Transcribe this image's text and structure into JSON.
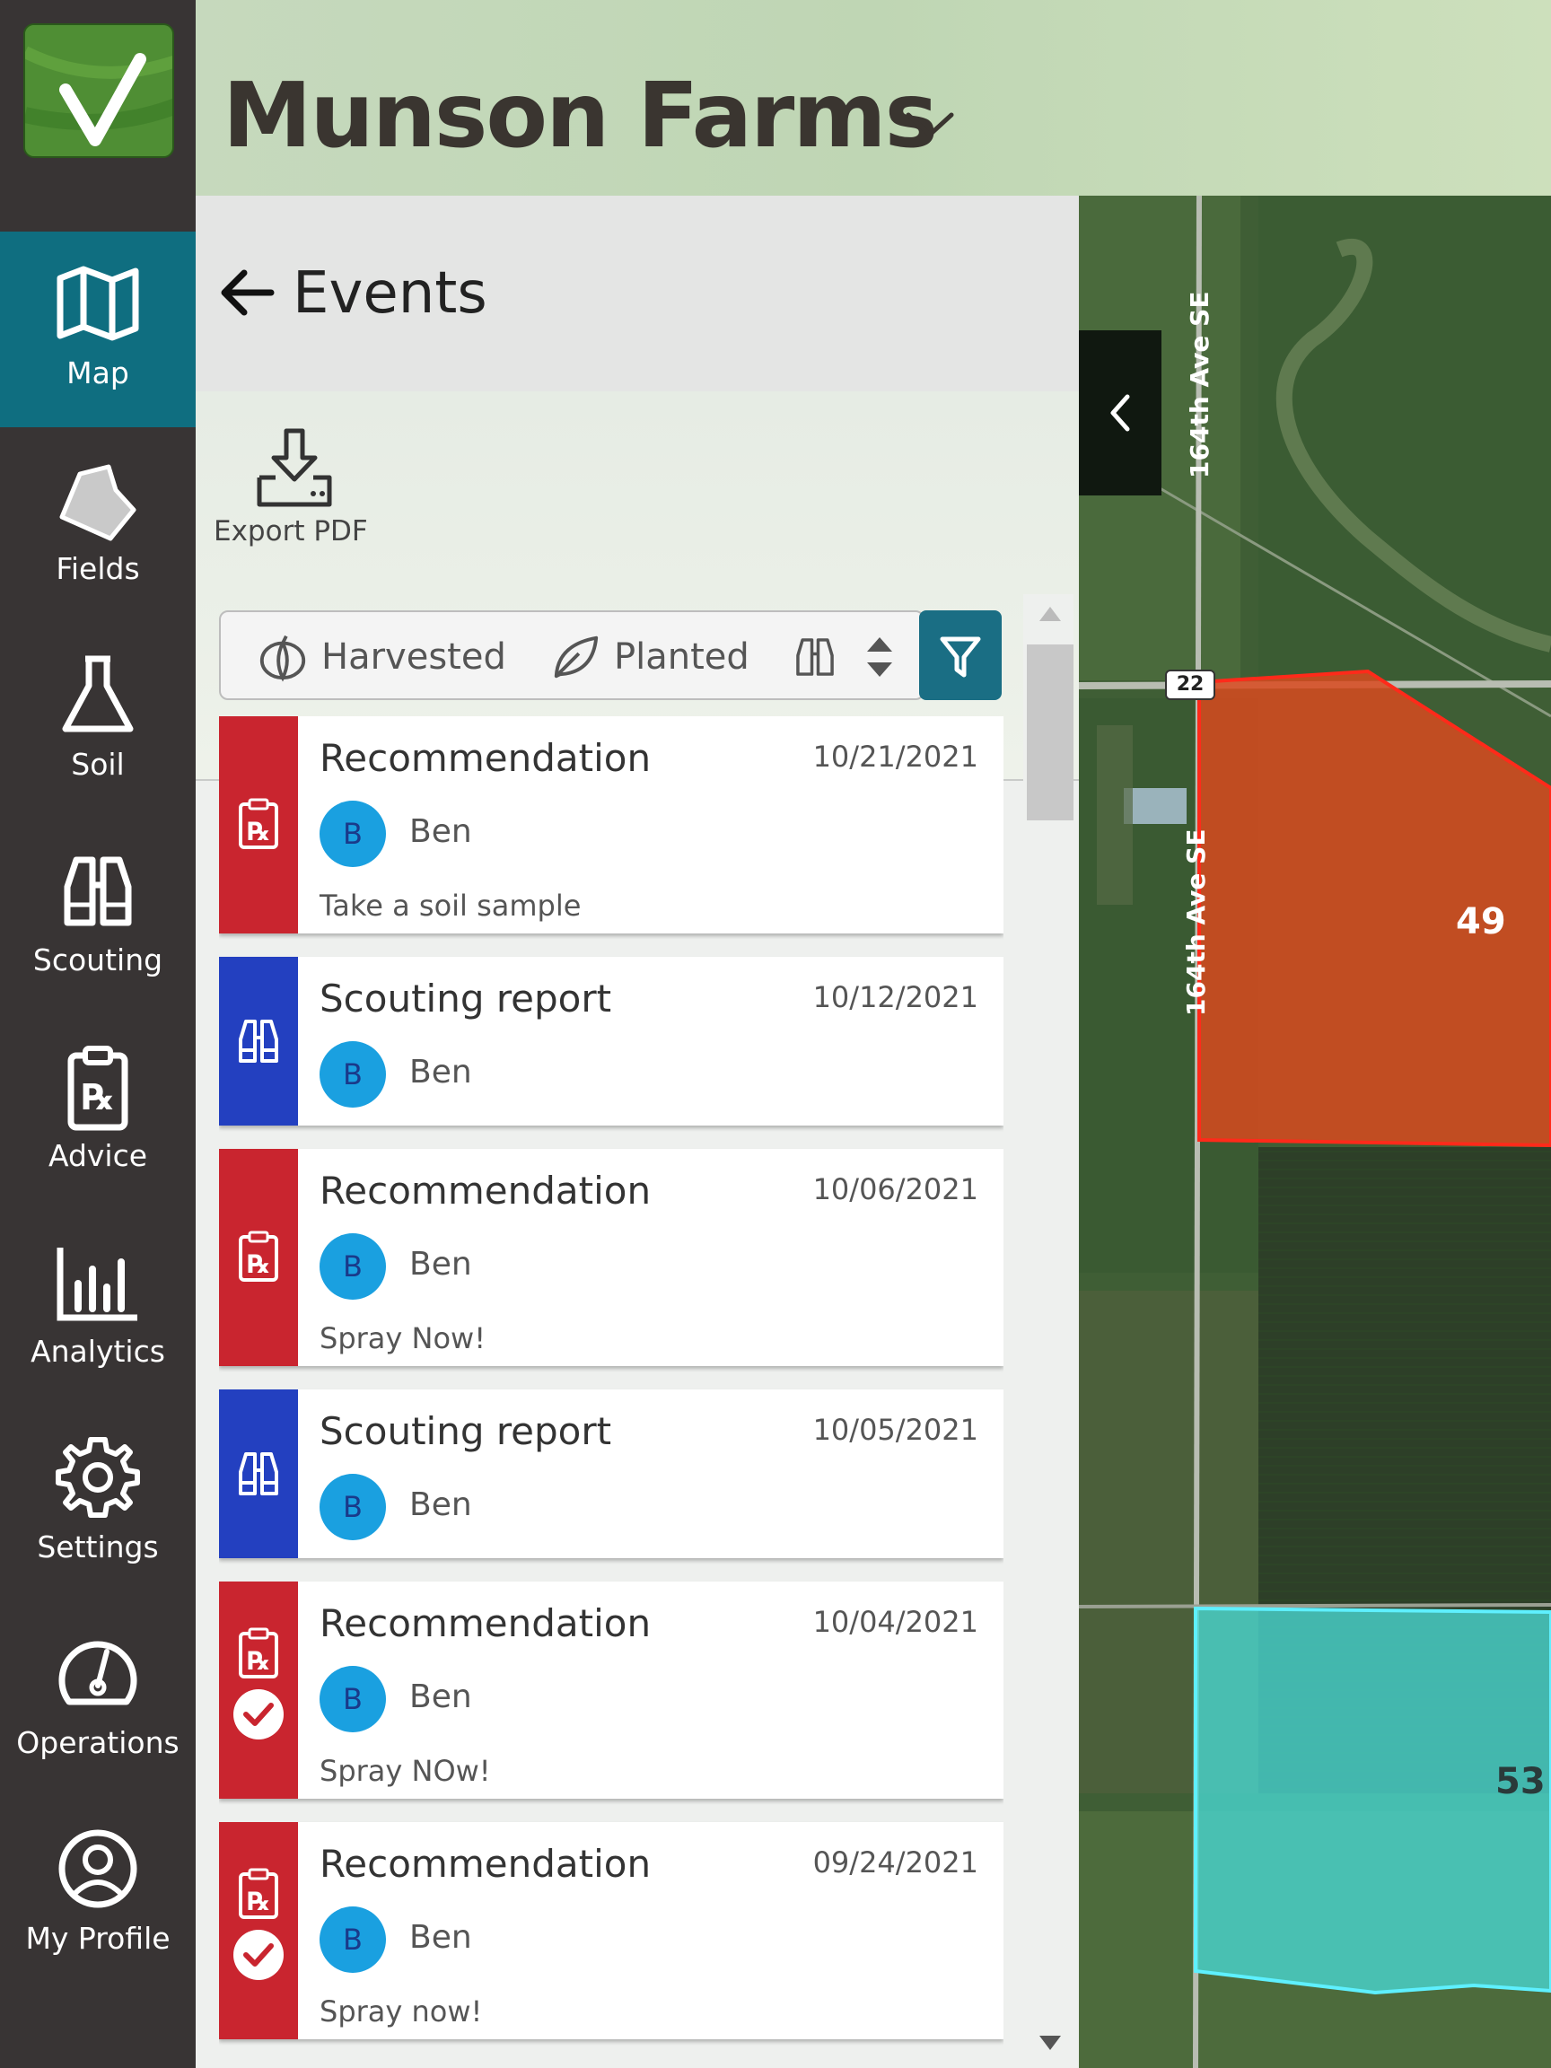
{
  "header": {
    "title": "Munson Farms"
  },
  "nav": {
    "items": [
      {
        "label": "Map",
        "icon": "map-icon"
      },
      {
        "label": "Fields",
        "icon": "field-shape-icon"
      },
      {
        "label": "Soil",
        "icon": "flask-icon"
      },
      {
        "label": "Scouting",
        "icon": "binoculars-icon"
      },
      {
        "label": "Advice",
        "icon": "prescription-clipboard-icon"
      },
      {
        "label": "Analytics",
        "icon": "bar-chart-icon"
      },
      {
        "label": "Settings",
        "icon": "gear-icon"
      },
      {
        "label": "Operations",
        "icon": "gauge-icon"
      },
      {
        "label": "My Profile",
        "icon": "user-circle-icon"
      }
    ]
  },
  "panel": {
    "title": "Events",
    "export_label": "Export PDF",
    "filters": {
      "harvested": "Harvested",
      "planted": "Planted"
    }
  },
  "events": [
    {
      "type": "Recommendation",
      "date": "10/21/2021",
      "avatar": "B",
      "user": "Ben",
      "note": "Take a soil sample",
      "completed": false
    },
    {
      "type": "Scouting report",
      "date": "10/12/2021",
      "avatar": "B",
      "user": "Ben",
      "note": "",
      "completed": false
    },
    {
      "type": "Recommendation",
      "date": "10/06/2021",
      "avatar": "B",
      "user": "Ben",
      "note": "Spray Now!",
      "completed": false
    },
    {
      "type": "Scouting report",
      "date": "10/05/2021",
      "avatar": "B",
      "user": "Ben",
      "note": "",
      "completed": false
    },
    {
      "type": "Recommendation",
      "date": "10/04/2021",
      "avatar": "B",
      "user": "Ben",
      "note": "Spray NOw!",
      "completed": true
    },
    {
      "type": "Recommendation",
      "date": "09/24/2021",
      "avatar": "B",
      "user": "Ben",
      "note": "Spray now!",
      "completed": true
    }
  ],
  "map": {
    "road_label_1": "164th Ave SE",
    "road_label_2": "164th Ave SE",
    "route_shield": "22",
    "field_red_label": "49",
    "field_cyan_label": "53",
    "colors": {
      "field_red": "#e0401c",
      "field_cyan": "#49d6d0"
    }
  }
}
